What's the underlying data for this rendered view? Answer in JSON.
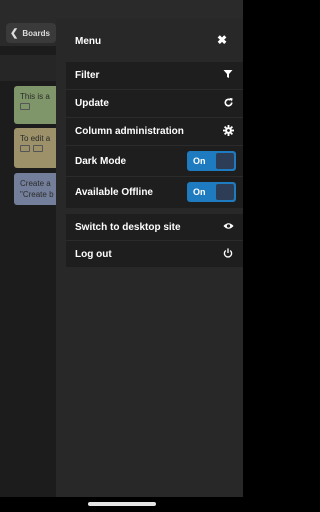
{
  "background": {
    "back_button_label": "Boards",
    "cards": [
      {
        "line1": "This is a"
      },
      {
        "line1": "To edit a"
      },
      {
        "line1": "Create a",
        "line2": "\"Create b"
      }
    ]
  },
  "menu": {
    "title": "Menu",
    "primary_items": [
      {
        "label": "Filter",
        "icon": "filter-icon"
      },
      {
        "label": "Update",
        "icon": "refresh-icon"
      },
      {
        "label": "Column administration",
        "icon": "gear-icon"
      }
    ],
    "toggles": [
      {
        "label": "Dark Mode",
        "value": "On"
      },
      {
        "label": "Available Offline",
        "value": "On"
      }
    ],
    "secondary_items": [
      {
        "label": "Switch to desktop site",
        "icon": "eye-icon"
      },
      {
        "label": "Log out",
        "icon": "power-icon"
      }
    ]
  },
  "colors": {
    "panel": "#282828",
    "section": "#1e1e1e",
    "toggle_accent": "#1f7bbf",
    "card_green": "#7e9669",
    "card_yellow": "#9c9169",
    "card_blue": "#737f9a"
  }
}
